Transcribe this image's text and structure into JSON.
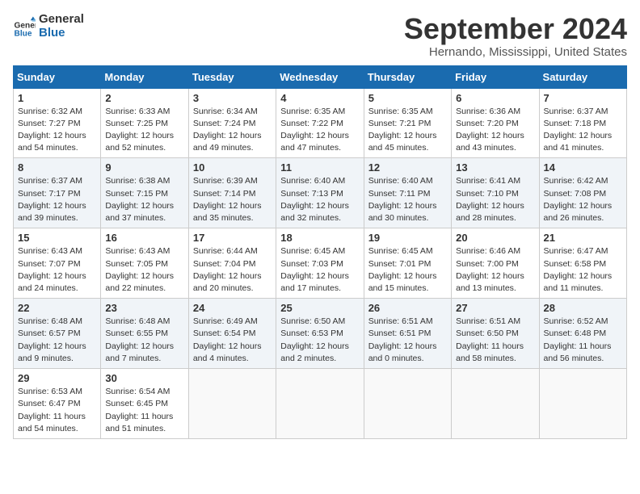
{
  "logo": {
    "line1": "General",
    "line2": "Blue"
  },
  "title": "September 2024",
  "location": "Hernando, Mississippi, United States",
  "days_of_week": [
    "Sunday",
    "Monday",
    "Tuesday",
    "Wednesday",
    "Thursday",
    "Friday",
    "Saturday"
  ],
  "weeks": [
    [
      {
        "day": "1",
        "info": "Sunrise: 6:32 AM\nSunset: 7:27 PM\nDaylight: 12 hours\nand 54 minutes."
      },
      {
        "day": "2",
        "info": "Sunrise: 6:33 AM\nSunset: 7:25 PM\nDaylight: 12 hours\nand 52 minutes."
      },
      {
        "day": "3",
        "info": "Sunrise: 6:34 AM\nSunset: 7:24 PM\nDaylight: 12 hours\nand 49 minutes."
      },
      {
        "day": "4",
        "info": "Sunrise: 6:35 AM\nSunset: 7:22 PM\nDaylight: 12 hours\nand 47 minutes."
      },
      {
        "day": "5",
        "info": "Sunrise: 6:35 AM\nSunset: 7:21 PM\nDaylight: 12 hours\nand 45 minutes."
      },
      {
        "day": "6",
        "info": "Sunrise: 6:36 AM\nSunset: 7:20 PM\nDaylight: 12 hours\nand 43 minutes."
      },
      {
        "day": "7",
        "info": "Sunrise: 6:37 AM\nSunset: 7:18 PM\nDaylight: 12 hours\nand 41 minutes."
      }
    ],
    [
      {
        "day": "8",
        "info": "Sunrise: 6:37 AM\nSunset: 7:17 PM\nDaylight: 12 hours\nand 39 minutes."
      },
      {
        "day": "9",
        "info": "Sunrise: 6:38 AM\nSunset: 7:15 PM\nDaylight: 12 hours\nand 37 minutes."
      },
      {
        "day": "10",
        "info": "Sunrise: 6:39 AM\nSunset: 7:14 PM\nDaylight: 12 hours\nand 35 minutes."
      },
      {
        "day": "11",
        "info": "Sunrise: 6:40 AM\nSunset: 7:13 PM\nDaylight: 12 hours\nand 32 minutes."
      },
      {
        "day": "12",
        "info": "Sunrise: 6:40 AM\nSunset: 7:11 PM\nDaylight: 12 hours\nand 30 minutes."
      },
      {
        "day": "13",
        "info": "Sunrise: 6:41 AM\nSunset: 7:10 PM\nDaylight: 12 hours\nand 28 minutes."
      },
      {
        "day": "14",
        "info": "Sunrise: 6:42 AM\nSunset: 7:08 PM\nDaylight: 12 hours\nand 26 minutes."
      }
    ],
    [
      {
        "day": "15",
        "info": "Sunrise: 6:43 AM\nSunset: 7:07 PM\nDaylight: 12 hours\nand 24 minutes."
      },
      {
        "day": "16",
        "info": "Sunrise: 6:43 AM\nSunset: 7:05 PM\nDaylight: 12 hours\nand 22 minutes."
      },
      {
        "day": "17",
        "info": "Sunrise: 6:44 AM\nSunset: 7:04 PM\nDaylight: 12 hours\nand 20 minutes."
      },
      {
        "day": "18",
        "info": "Sunrise: 6:45 AM\nSunset: 7:03 PM\nDaylight: 12 hours\nand 17 minutes."
      },
      {
        "day": "19",
        "info": "Sunrise: 6:45 AM\nSunset: 7:01 PM\nDaylight: 12 hours\nand 15 minutes."
      },
      {
        "day": "20",
        "info": "Sunrise: 6:46 AM\nSunset: 7:00 PM\nDaylight: 12 hours\nand 13 minutes."
      },
      {
        "day": "21",
        "info": "Sunrise: 6:47 AM\nSunset: 6:58 PM\nDaylight: 12 hours\nand 11 minutes."
      }
    ],
    [
      {
        "day": "22",
        "info": "Sunrise: 6:48 AM\nSunset: 6:57 PM\nDaylight: 12 hours\nand 9 minutes."
      },
      {
        "day": "23",
        "info": "Sunrise: 6:48 AM\nSunset: 6:55 PM\nDaylight: 12 hours\nand 7 minutes."
      },
      {
        "day": "24",
        "info": "Sunrise: 6:49 AM\nSunset: 6:54 PM\nDaylight: 12 hours\nand 4 minutes."
      },
      {
        "day": "25",
        "info": "Sunrise: 6:50 AM\nSunset: 6:53 PM\nDaylight: 12 hours\nand 2 minutes."
      },
      {
        "day": "26",
        "info": "Sunrise: 6:51 AM\nSunset: 6:51 PM\nDaylight: 12 hours\nand 0 minutes."
      },
      {
        "day": "27",
        "info": "Sunrise: 6:51 AM\nSunset: 6:50 PM\nDaylight: 11 hours\nand 58 minutes."
      },
      {
        "day": "28",
        "info": "Sunrise: 6:52 AM\nSunset: 6:48 PM\nDaylight: 11 hours\nand 56 minutes."
      }
    ],
    [
      {
        "day": "29",
        "info": "Sunrise: 6:53 AM\nSunset: 6:47 PM\nDaylight: 11 hours\nand 54 minutes."
      },
      {
        "day": "30",
        "info": "Sunrise: 6:54 AM\nSunset: 6:45 PM\nDaylight: 11 hours\nand 51 minutes."
      },
      null,
      null,
      null,
      null,
      null
    ]
  ]
}
